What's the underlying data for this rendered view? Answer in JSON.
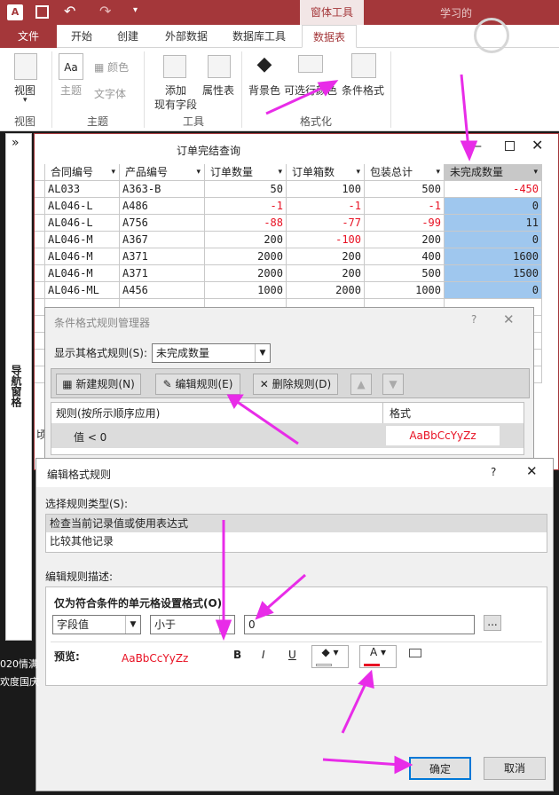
{
  "titlebar": {
    "context_tools": "窗体工具",
    "right_text": "学习的"
  },
  "tabs": [
    {
      "label": "文件"
    },
    {
      "label": "开始"
    },
    {
      "label": "创建"
    },
    {
      "label": "外部数据"
    },
    {
      "label": "数据库工具"
    },
    {
      "label": "数据表"
    }
  ],
  "ribbon": {
    "view": "视图",
    "theme": "主题",
    "color": "颜色",
    "font": "文字体",
    "add_field_1": "添加",
    "add_field_2": "现有字段",
    "property": "属性表",
    "bg_color": "背景色",
    "alt_row": "可选行颜色",
    "cond_format": "条件格式",
    "groups": {
      "view": "视图",
      "theme": "主题",
      "tools": "工具",
      "format": "格式化"
    }
  },
  "nav": {
    "toggle": "»",
    "label": "导航窗格"
  },
  "query": {
    "title": "订单完结查询",
    "columns": [
      "合同编号",
      "产品编号",
      "订单数量",
      "订单箱数",
      "包装总计",
      "未完成数量"
    ],
    "rows": [
      [
        "AL033",
        "A363-B",
        "50",
        "100",
        "500",
        "-450"
      ],
      [
        "AL046-L",
        "A486",
        "-1",
        "-1",
        "-1",
        "0"
      ],
      [
        "AL046-L",
        "A756",
        "-88",
        "-77",
        "-99",
        "11"
      ],
      [
        "AL046-M",
        "A367",
        "200",
        "-100",
        "200",
        "0"
      ],
      [
        "AL046-M",
        "A371",
        "2000",
        "200",
        "400",
        "1600"
      ],
      [
        "AL046-M",
        "A371",
        "2000",
        "200",
        "500",
        "1500"
      ],
      [
        "AL046-ML",
        "A456",
        "1000",
        "2000",
        "1000",
        "0"
      ]
    ],
    "row_fragment": "顷"
  },
  "mgr": {
    "title": "条件格式规则管理器",
    "help": "?",
    "show_label": "显示其格式规则(S):",
    "show_value": "未完成数量",
    "new_rule": "新建规则(N)",
    "edit_rule": "编辑规则(E)",
    "delete_rule": "删除规则(D)",
    "col_rule": "规则(按所示顺序应用)",
    "col_format": "格式",
    "rule_text": "值 < 0",
    "preview": "AaBbCcYyZz"
  },
  "edit": {
    "title": "编辑格式规则",
    "help": "?",
    "type_label": "选择规则类型(S):",
    "types": [
      "检查当前记录值或使用表达式",
      "比较其他记录"
    ],
    "desc_label": "编辑规则描述:",
    "cond_label": "仅为符合条件的单元格设置格式(O)",
    "field_value": "字段值",
    "op_value": "小于",
    "value": "0",
    "ellipsis": "...",
    "preview_label": "预览:",
    "preview": "AaBbCcYyZz",
    "bold": "B",
    "italic": "I",
    "underline": "U",
    "fontcolor": "A",
    "ok": "确定",
    "cancel": "取消"
  },
  "desktop": {
    "text1": "020情满",
    "text2": "欢度国庆"
  },
  "colors": {
    "accent": "#a4373a",
    "red_text": "#e81123",
    "highlight": "#9fc7ee",
    "arrow": "#e82ce8"
  }
}
